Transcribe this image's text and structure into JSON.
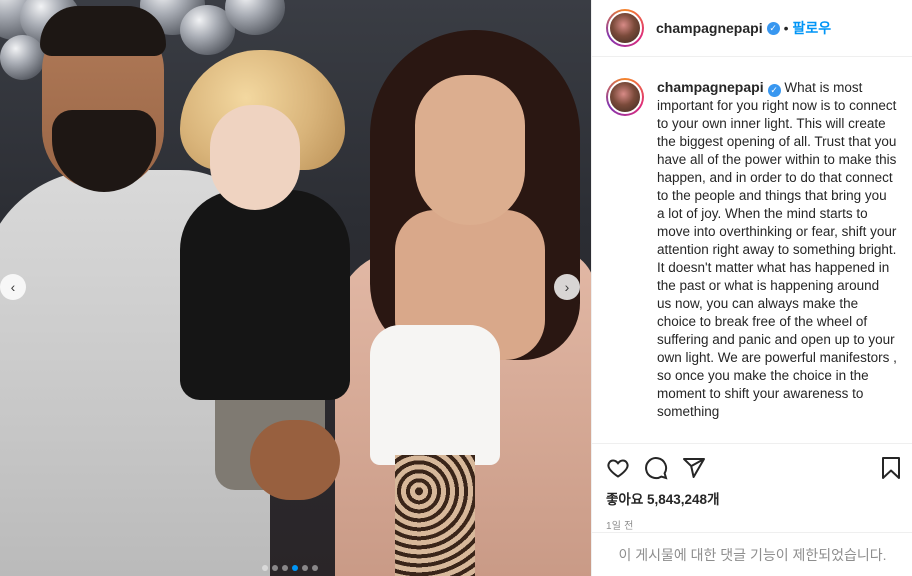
{
  "post": {
    "username": "champagnepapi",
    "separator": "•",
    "follow_label": "팔로우",
    "caption": "What is most important for you right now is to connect to your own inner light. This will create the biggest opening of all. Trust that you have all of the power within to make this happen, and in order to do that connect to the people and things that bring you a lot of joy. When the mind starts to move into overthinking or fear, shift your attention right away to something bright. It doesn't matter what has happened in the past or what is happening around us now, you can always make the choice to break free of the wheel of suffering and panic and open up to your own light. We are powerful manifestors , so once you make the choice in the moment to shift your awareness to something",
    "likes_text": "좋아요 5,843,248개",
    "timestamp": "1일 전",
    "comments_disabled_text": "이 게시물에 대한 댓글 기능이 제한되었습니다."
  },
  "carousel": {
    "prev_icon": "chevron-left-icon",
    "next_icon": "chevron-right-icon",
    "prev_glyph": "‹",
    "next_glyph": "›",
    "dot_count": 6,
    "active_dot": 3
  },
  "colors": {
    "accent": "#0095f6",
    "verified": "#3897f0",
    "muted": "#8e8e8e",
    "text": "#262626",
    "border": "#efefef"
  }
}
